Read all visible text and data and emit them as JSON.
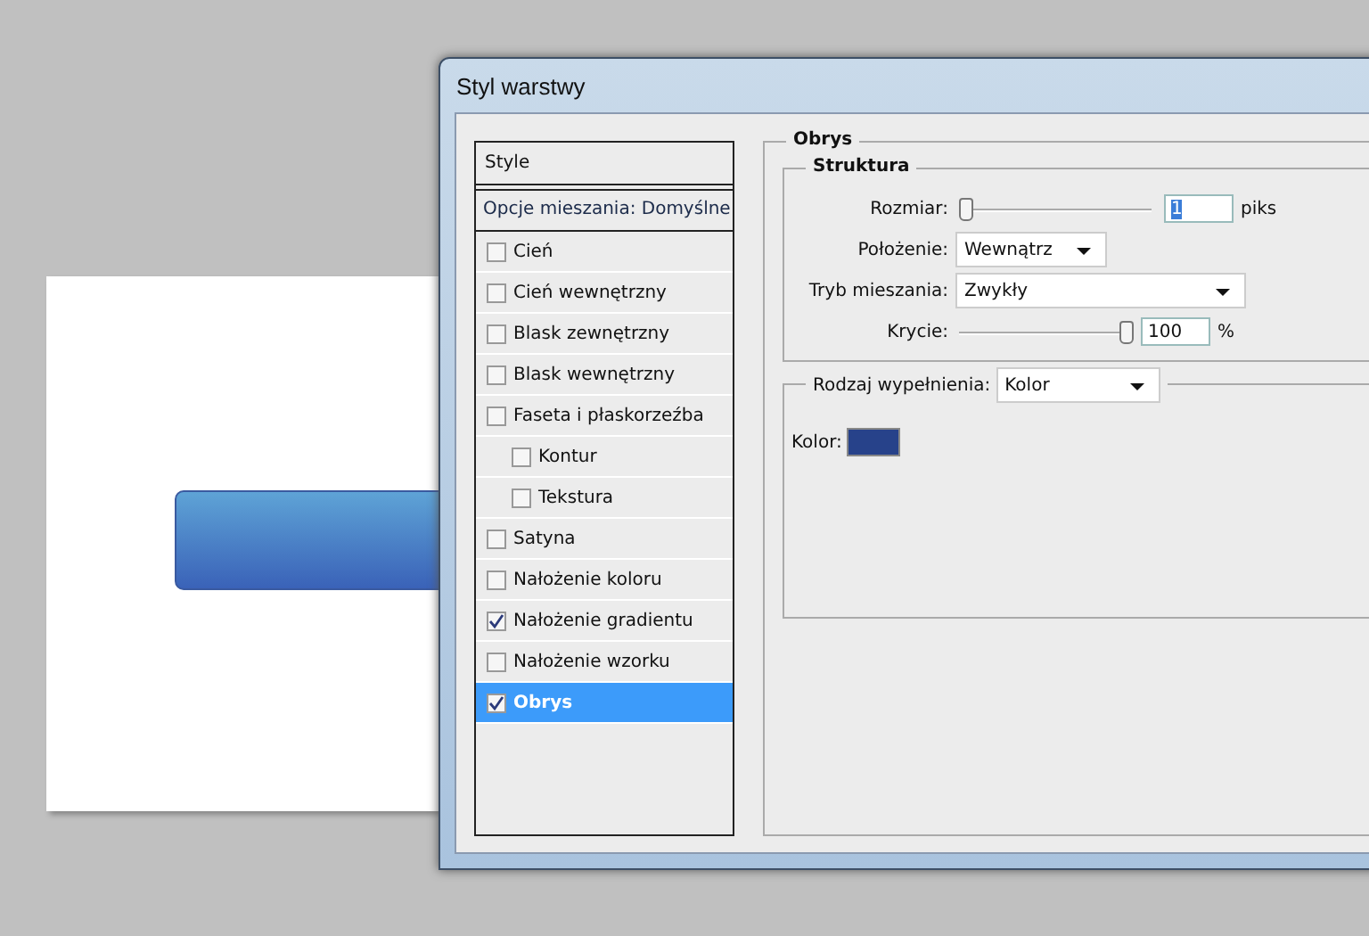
{
  "window": {
    "title": "Styl warstwy"
  },
  "styles_list": {
    "header": "Style",
    "blending_options": "Opcje mieszania: Domyślne",
    "items": [
      {
        "label": "Cień",
        "checked": false,
        "selected": false
      },
      {
        "label": "Cień wewnętrzny",
        "checked": false,
        "selected": false
      },
      {
        "label": "Blask zewnętrzny",
        "checked": false,
        "selected": false
      },
      {
        "label": "Blask wewnętrzny",
        "checked": false,
        "selected": false
      },
      {
        "label": "Faseta i płaskorzeźba",
        "checked": false,
        "selected": false,
        "children": [
          {
            "label": "Kontur",
            "checked": false,
            "selected": false
          },
          {
            "label": "Tekstura",
            "checked": false,
            "selected": false
          }
        ]
      },
      {
        "label": "Satyna",
        "checked": false,
        "selected": false
      },
      {
        "label": "Nałożenie koloru",
        "checked": false,
        "selected": false
      },
      {
        "label": "Nałożenie gradientu",
        "checked": true,
        "selected": false
      },
      {
        "label": "Nałożenie wzorku",
        "checked": false,
        "selected": false
      },
      {
        "label": "Obrys",
        "checked": true,
        "selected": true
      }
    ]
  },
  "stroke": {
    "title": "Obrys",
    "structure": {
      "title": "Struktura",
      "size": {
        "label": "Rozmiar:",
        "level": 0,
        "value": "1",
        "highlighted": true,
        "unit": "piks"
      },
      "position": {
        "label": "Położenie:",
        "value": "Wewnątrz"
      },
      "blend_mode": {
        "label": "Tryb mieszania:",
        "value": "Zwykły"
      },
      "opacity": {
        "label": "Krycie:",
        "level": 1,
        "value": "100",
        "highlighted": false,
        "unit": "%"
      }
    },
    "fill": {
      "label": "Rodzaj wypełnienia:",
      "value": "Kolor",
      "color_label": "Kolor:",
      "color": "#27428a"
    }
  }
}
